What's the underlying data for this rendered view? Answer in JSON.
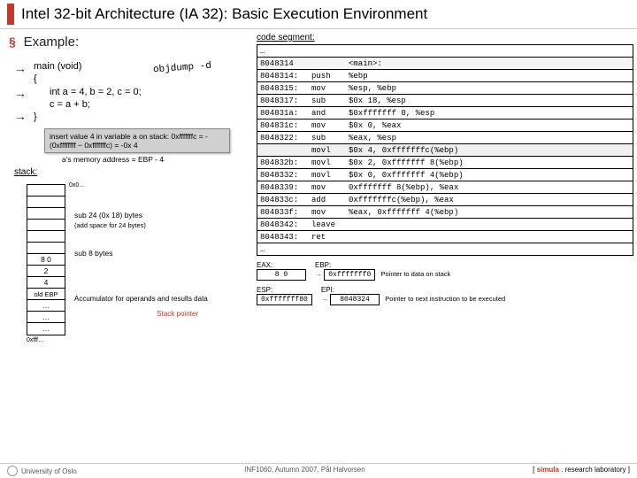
{
  "title": "Intel 32-bit Architecture (IA 32): Basic Execution Environment",
  "example_label": "Example:",
  "code": {
    "l1": "main (void)",
    "l2": "{",
    "l3": "int a = 4, b = 2, c = 0;",
    "l4": "c = a + b;",
    "l5": "}"
  },
  "objdump": "objdump -d",
  "notes": {
    "insert": "insert value 4 in variable a on stack: 0xfffffffc = -(0xffffffff − 0xfffffffc) = -0x 4",
    "mem_addr": "a's memory address = EBP - 4",
    "sub24": "sub 24 (0x 18) bytes",
    "addspace": "(add space for 24 bytes)",
    "sub8": "sub 8 bytes"
  },
  "stack_label": "stack:",
  "hex_top": "0x0…",
  "hex_bot": "0xfff…",
  "stack_cells": [
    "",
    "",
    "",
    "",
    "",
    "",
    "8 0",
    "2",
    "4",
    "old EBP",
    "…",
    "…",
    "…"
  ],
  "accum": "Accumulator for operands and results data",
  "sp": "Stack pointer",
  "cs_label": "code segment:",
  "cs": [
    {
      "addr": "…",
      "op": "",
      "arg": ""
    },
    {
      "addr": "8048314",
      "op": "",
      "arg": "<main>:",
      "header": true
    },
    {
      "addr": "8048314:",
      "op": "push",
      "arg": "%ebp"
    },
    {
      "addr": "8048315:",
      "op": "mov",
      "arg": "%esp, %ebp"
    },
    {
      "addr": "8048317:",
      "op": "sub",
      "arg": "$0x 18, %esp"
    },
    {
      "addr": "804831a:",
      "op": "and",
      "arg": "$0xfffffff 0, %esp"
    },
    {
      "addr": "804831c:",
      "op": "mov",
      "arg": "$0x 0, %eax"
    },
    {
      "addr": "8048322:",
      "op": "sub",
      "arg": "%eax, %esp"
    },
    {
      "addr": "",
      "op": "movl",
      "arg": "$0x 4, 0xfffffffc(%ebp)",
      "hl": true
    },
    {
      "addr": "804832b:",
      "op": "movl",
      "arg": "$0x 2, 0xfffffff 8(%ebp)"
    },
    {
      "addr": "8048332:",
      "op": "movl",
      "arg": "$0x 0, 0xfffffff 4(%ebp)"
    },
    {
      "addr": "8048339:",
      "op": "mov",
      "arg": "0xfffffff 8(%ebp), %eax"
    },
    {
      "addr": "804833c:",
      "op": "add",
      "arg": "0xfffffffc(%ebp), %eax"
    },
    {
      "addr": "804833f:",
      "op": "mov",
      "arg": "%eax, 0xfffffff 4(%ebp)"
    },
    {
      "addr": "8048342:",
      "op": "leave",
      "arg": ""
    },
    {
      "addr": "8048343:",
      "op": "ret",
      "arg": ""
    },
    {
      "addr": "…",
      "op": "",
      "arg": ""
    }
  ],
  "regs": {
    "eax_lbl": "EAX:",
    "eax_val": "8 0",
    "ebp_lbl": "EBP:",
    "ebp_val": "0xfffffff0",
    "ebp_desc": "Pointer to data on stack",
    "esp_lbl": "ESP:",
    "esp_val": "0xfffffff80",
    "epi_lbl": "EPI:",
    "epi_val": "8048324",
    "epi_desc": "Pointer to next instruction to be executed"
  },
  "footer": {
    "univ": "University of Oslo",
    "course": "INF1060, Autumn 2007, Pål Halvorsen",
    "lab": "[ simula . research laboratory ]"
  }
}
